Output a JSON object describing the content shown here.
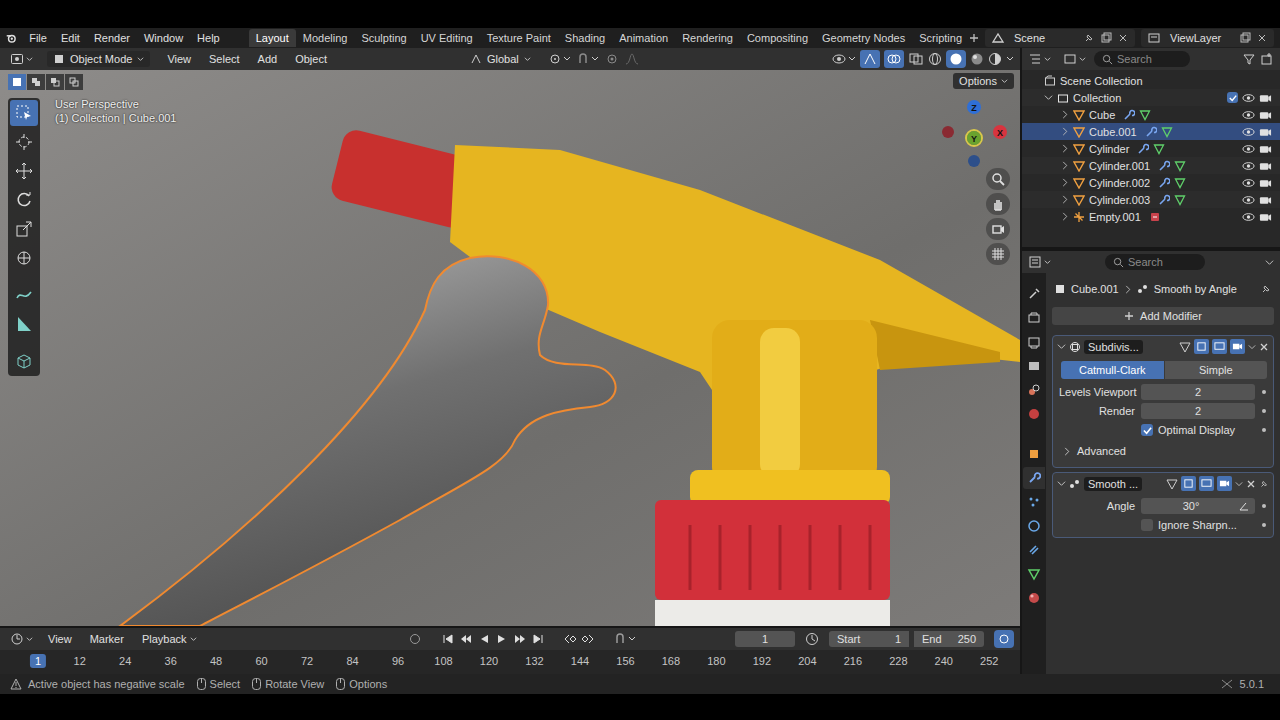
{
  "top_bar": {
    "menus": [
      "File",
      "Edit",
      "Render",
      "Window",
      "Help"
    ],
    "workspaces": [
      {
        "label": "Layout",
        "selected": true
      },
      {
        "label": "Modeling",
        "selected": false
      },
      {
        "label": "Sculpting",
        "selected": false
      },
      {
        "label": "UV Editing",
        "selected": false
      },
      {
        "label": "Texture Paint",
        "selected": false
      },
      {
        "label": "Shading",
        "selected": false
      },
      {
        "label": "Animation",
        "selected": false
      },
      {
        "label": "Rendering",
        "selected": false
      },
      {
        "label": "Compositing",
        "selected": false
      },
      {
        "label": "Geometry Nodes",
        "selected": false
      },
      {
        "label": "Scripting",
        "selected": false
      }
    ],
    "scene": "Scene",
    "view_layer": "ViewLayer"
  },
  "viewport": {
    "mode": "Object Mode",
    "menus": [
      "View",
      "Select",
      "Add",
      "Object"
    ],
    "orientation": "Global",
    "options_button": "Options",
    "info": [
      "User Perspective",
      "(1) Collection | Cube.001"
    ],
    "gizmo": [
      {
        "label": "Z",
        "color": "#2f6fd6"
      },
      {
        "label": "Y",
        "color": "#6aa32e"
      },
      {
        "label": "X",
        "color": "#d8343f"
      }
    ]
  },
  "outliner": {
    "search_placeholder": "Search",
    "root": "Scene Collection",
    "collection": {
      "name": "Collection",
      "checked": true
    },
    "items": [
      {
        "name": "Cube",
        "kind": "mesh",
        "selected": false
      },
      {
        "name": "Cube.001",
        "kind": "mesh",
        "selected": true
      },
      {
        "name": "Cylinder",
        "kind": "mesh",
        "selected": false
      },
      {
        "name": "Cylinder.001",
        "kind": "mesh",
        "selected": false
      },
      {
        "name": "Cylinder.002",
        "kind": "mesh",
        "selected": false
      },
      {
        "name": "Cylinder.003",
        "kind": "mesh",
        "selected": false
      },
      {
        "name": "Empty.001",
        "kind": "empty",
        "selected": false
      }
    ]
  },
  "properties": {
    "search_placeholder": "Search",
    "object": "Cube.001",
    "active_modifier": "Smooth by Angle",
    "add_modifier": "Add Modifier",
    "modifiers": [
      {
        "kind": "subdivision",
        "name": "Subdivis...",
        "expanded": true,
        "pinned": false,
        "options": [
          {
            "label": "Catmull-Clark",
            "selected": true
          },
          {
            "label": "Simple",
            "selected": false
          }
        ],
        "fields": [
          {
            "label": "Levels Viewport",
            "value": "2"
          },
          {
            "label": "Render",
            "value": "2"
          }
        ],
        "checkbox": {
          "label": "Optimal Display",
          "checked": true
        },
        "subpanel": {
          "label": "Advanced",
          "expanded": false
        }
      },
      {
        "kind": "smooth",
        "name": "Smooth ...",
        "expanded": true,
        "pinned": true,
        "options": [],
        "fields": [
          {
            "label": "Angle",
            "value": "30°"
          }
        ],
        "checkbox": {
          "label": "Ignore Sharpn...",
          "checked": false
        },
        "subpanel": null
      }
    ]
  },
  "timeline": {
    "menus": [
      "View",
      "Marker",
      "Playback"
    ],
    "current_frame": "1",
    "start_label": "Start",
    "start": "1",
    "end_label": "End",
    "end": "250",
    "ticks": [
      {
        "label": "1",
        "selected": true
      },
      {
        "label": "12",
        "selected": false
      },
      {
        "label": "24",
        "selected": false
      },
      {
        "label": "36",
        "selected": false
      },
      {
        "label": "48",
        "selected": false
      },
      {
        "label": "60",
        "selected": false
      },
      {
        "label": "72",
        "selected": false
      },
      {
        "label": "84",
        "selected": false
      },
      {
        "label": "96",
        "selected": false
      },
      {
        "label": "108",
        "selected": false
      },
      {
        "label": "120",
        "selected": false
      },
      {
        "label": "132",
        "selected": false
      },
      {
        "label": "144",
        "selected": false
      },
      {
        "label": "156",
        "selected": false
      },
      {
        "label": "168",
        "selected": false
      },
      {
        "label": "180",
        "selected": false
      },
      {
        "label": "192",
        "selected": false
      },
      {
        "label": "204",
        "selected": false
      },
      {
        "label": "216",
        "selected": false
      },
      {
        "label": "228",
        "selected": false
      },
      {
        "label": "240",
        "selected": false
      },
      {
        "label": "252",
        "selected": false
      }
    ]
  },
  "status_bar": {
    "warning": "Active object has negative scale",
    "hints": [
      "Select",
      "Rotate View",
      "Options"
    ],
    "version": "5.0.1"
  }
}
